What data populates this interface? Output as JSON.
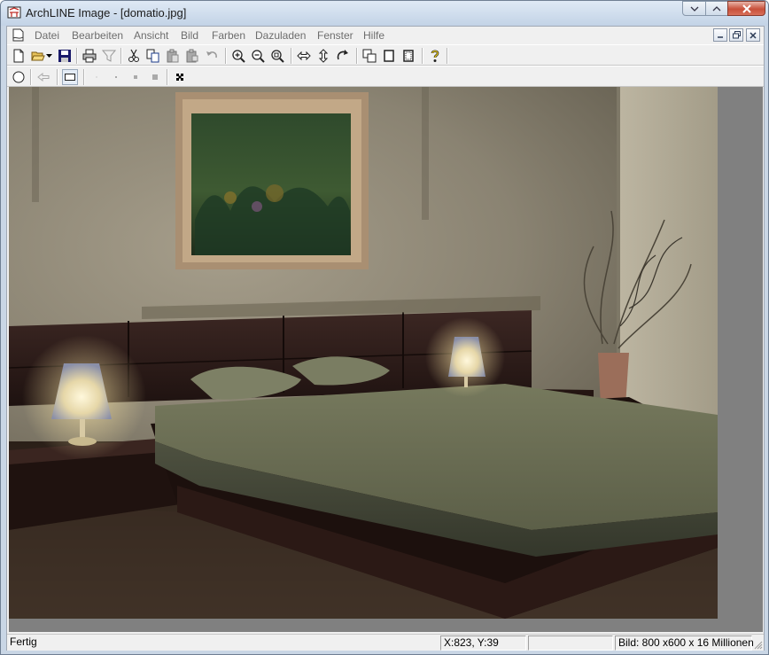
{
  "window": {
    "title": "ArchLINE Image - [domatio.jpg]"
  },
  "menu": {
    "items": [
      {
        "id": "datei",
        "label": "Datei"
      },
      {
        "id": "bearbeiten",
        "label": "Bearbeiten"
      },
      {
        "id": "ansicht",
        "label": "Ansicht"
      },
      {
        "id": "bild",
        "label": "Bild"
      },
      {
        "id": "farben",
        "label": "Farben"
      },
      {
        "id": "dazuladen",
        "label": "Dazuladen"
      },
      {
        "id": "fenster",
        "label": "Fenster"
      },
      {
        "id": "hilfe",
        "label": "Hilfe"
      }
    ]
  },
  "toolbar_main": [
    "new-file-icon",
    "open-folder-icon",
    "dropdown-arrow-icon",
    "save-disk-icon",
    "print-icon",
    "funnel-icon",
    "cut-icon",
    "copy-icon",
    "paste-icon",
    "paste-special-icon",
    "undo-icon",
    "zoom-in-icon",
    "zoom-out-icon",
    "zoom-fit-icon",
    "flip-horizontal-icon",
    "flip-vertical-icon",
    "rotate-icon",
    "resize-canvas-icon",
    "crop-frame-icon",
    "border-frame-icon",
    "help-icon"
  ],
  "toolbar_select": [
    "circle-select-icon",
    "back-arrow-icon",
    "rectangle-select-icon",
    "brush-size-1-icon",
    "brush-size-2-icon",
    "brush-size-3-icon",
    "brush-size-4-icon",
    "scatter-icon"
  ],
  "status": {
    "text": "Fertig",
    "coords": "X:823, Y:39",
    "empty": "",
    "info": "Bild: 800 x600 x 16 Millionen"
  },
  "colors": {
    "accent": "#c9d6e5",
    "close_button": "#c8503a",
    "menu_text_disabled": "#6d6d6d",
    "viewport_bg": "#808080"
  }
}
